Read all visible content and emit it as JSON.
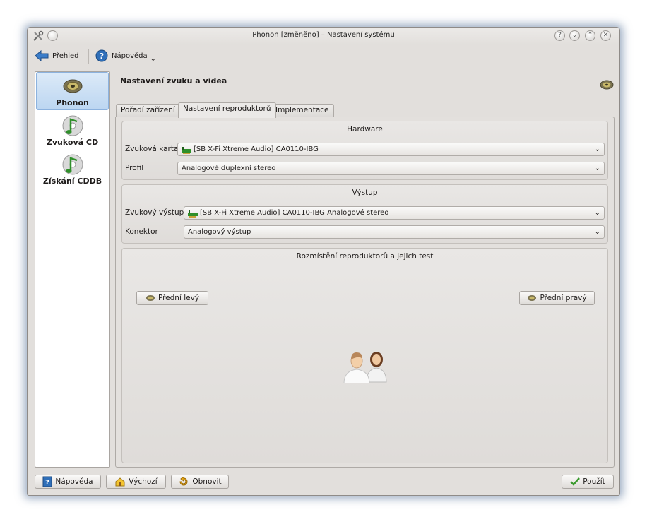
{
  "window": {
    "title": "Phonon [změněno] – Nastavení systému"
  },
  "toolbar": {
    "overview_label": "Přehled",
    "help_label": "Nápověda"
  },
  "sidebar": {
    "items": [
      {
        "label": "Phonon",
        "icon": "speaker-icon"
      },
      {
        "label": "Zvuková CD",
        "icon": "music-cd-icon"
      },
      {
        "label": "Získání CDDB",
        "icon": "music-cd-icon"
      }
    ]
  },
  "page": {
    "title": "Nastavení zvuku a videa"
  },
  "tabs": [
    {
      "label": "Pořadí zařízení"
    },
    {
      "label": "Nastavení reproduktorů"
    },
    {
      "label": "Implementace"
    }
  ],
  "hardware": {
    "title": "Hardware",
    "card_label": "Zvuková karta",
    "card_value": "[SB X-Fi Xtreme Audio] CA0110-IBG",
    "profile_label": "Profil",
    "profile_value": "Analogové duplexní stereo"
  },
  "output": {
    "title": "Výstup",
    "sound_output_label": "Zvukový výstup",
    "sound_output_value": "[SB X-Fi Xtreme Audio] CA0110-IBG Analogové stereo",
    "connector_label": "Konektor",
    "connector_value": "Analogový výstup"
  },
  "speakers": {
    "title": "Rozmístění reproduktorů a jejich test",
    "front_left": "Přední levý",
    "front_right": "Přední pravý"
  },
  "footer": {
    "help_label": "Nápověda",
    "defaults_label": "Výchozí",
    "reset_label": "Obnovit",
    "apply_label": "Použít"
  },
  "colors": {
    "accent": "#bcd6f1",
    "window_bg": "#e2dfdc",
    "apply_check": "#3a9a2e"
  }
}
